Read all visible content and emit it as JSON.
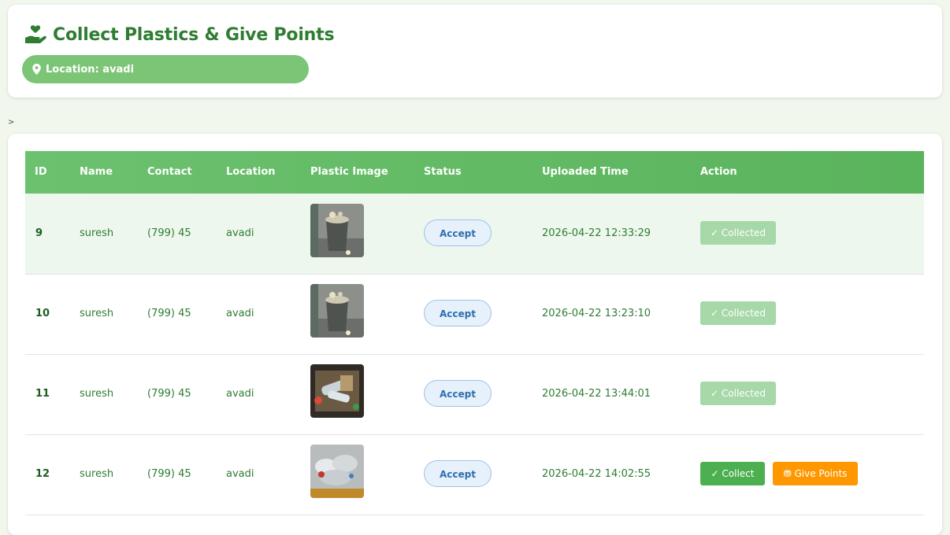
{
  "header": {
    "title": "Collect Plastics & Give Points",
    "location": "Location: avadi"
  },
  "caret": ">",
  "table": {
    "columns": [
      "ID",
      "Name",
      "Contact",
      "Location",
      "Plastic Image",
      "Status",
      "Uploaded Time",
      "Action"
    ],
    "rows": [
      {
        "id": "9",
        "name": "suresh",
        "contact": "(799) 45",
        "location": "avadi",
        "image": "trash-bin-photo",
        "status": "Accept",
        "uploaded": "2026-04-22 12:33:29",
        "action": "✓ Collected"
      },
      {
        "id": "10",
        "name": "suresh",
        "contact": "(799) 45",
        "location": "avadi",
        "image": "trash-bin-photo",
        "status": "Accept",
        "uploaded": "2026-04-22 13:23:10",
        "action": "✓ Collected"
      },
      {
        "id": "11",
        "name": "suresh",
        "contact": "(799) 45",
        "location": "avadi",
        "image": "plastic-bottles-photo",
        "status": "Accept",
        "uploaded": "2026-04-22 13:44:01",
        "action": "✓ Collected"
      },
      {
        "id": "12",
        "name": "suresh",
        "contact": "(799) 45",
        "location": "avadi",
        "image": "plastic-waste-pile-photo",
        "status": "Accept",
        "uploaded": "2026-04-22 14:02:55",
        "action": "✓ Collect",
        "action2": "Give Points"
      }
    ]
  },
  "colors": {
    "accent": "#2e7d32",
    "header_green": "#5ab45c",
    "collected": "#a6d8a8",
    "collect": "#4caf50",
    "points": "#ff9800"
  },
  "icons": {
    "title": "hand-holding-heart-icon",
    "location": "map-pin-icon",
    "points": "coins-icon"
  }
}
